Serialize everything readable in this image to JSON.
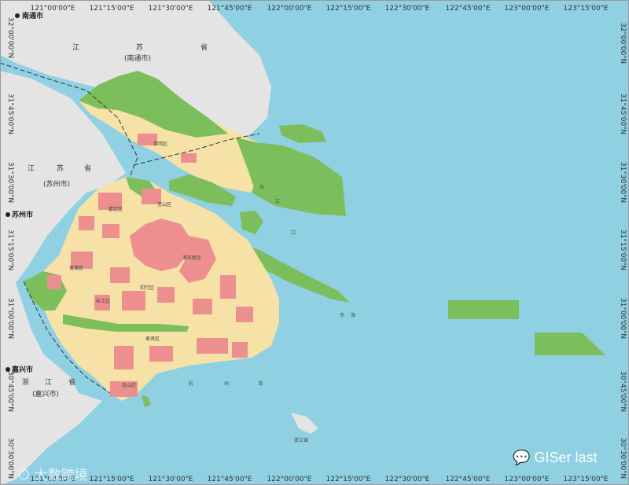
{
  "map": {
    "top_ticks": [
      "121°00'00\"E",
      "121°15'00\"E",
      "121°30'00\"E",
      "121°45'00\"E",
      "122°00'00\"E",
      "122°15'00\"E",
      "122°30'00\"E",
      "122°45'00\"E",
      "123°00'00\"E",
      "123°15'00\"E"
    ],
    "bottom_ticks": [
      "121°00'00\"E",
      "121°15'00\"E",
      "121°30'00\"E",
      "121°45'00\"E",
      "122°00'00\"E",
      "122°15'00\"E",
      "122°30'00\"E",
      "122°45'00\"E",
      "123°00'00\"E",
      "123°15'00\"E"
    ],
    "left_ticks": [
      "32°00'00\"N",
      "31°45'00\"N",
      "31°30'00\"N",
      "31°15'00\"N",
      "31°00'00\"N",
      "30°45'00\"N",
      "30°30'00\"N"
    ],
    "right_ticks": [
      "32°00'00\"N",
      "31°45'00\"N",
      "31°30'00\"N",
      "31°15'00\"N",
      "31°00'00\"N",
      "30°45'00\"N",
      "30°30'00\"N"
    ],
    "cities": {
      "nantong": "南通市",
      "suzhou": "苏州市",
      "jiaxing": "嘉兴市"
    },
    "regions": {
      "jiangsu_top_1": "江",
      "jiangsu_top_2": "苏",
      "jiangsu_top_3": "省",
      "nantong_paren": "(南通市)",
      "jiangsu_left_1": "江",
      "jiangsu_left_2": "苏",
      "jiangsu_left_3": "省",
      "suzhou_paren": "(苏州市)",
      "zhejiang_1": "浙",
      "zhejiang_2": "江",
      "zhejiang_3": "省",
      "jiaxing_paren": "(嘉兴市)",
      "zhejiang_south": "浙江省"
    },
    "water_labels": {
      "changjiang_1": "长",
      "changjiang_2": "江",
      "changjiang_3": "口",
      "donghai_1": "东",
      "donghai_2": "海",
      "hangzhou_1": "杭",
      "hangzhou_2": "州",
      "hangzhou_3": "湾"
    },
    "district_labels": {
      "chongming": "崇明区",
      "baoshan": "宝山区",
      "jiading": "嘉定区",
      "qingpu": "青浦区",
      "songjiang": "松江区",
      "minhang": "闵行区",
      "pudong": "浦东新区",
      "jinshan": "金山区",
      "fengxian": "奉贤区"
    }
  },
  "watermarks": {
    "left_text": "大数跨境",
    "right_text": "GISer last"
  },
  "colors": {
    "sea": "#8fd0e3",
    "land_outside": "#e4e4e4",
    "urban": "#ee8f8f",
    "farmland": "#f6e2a6",
    "green": "#7cbd5c"
  }
}
